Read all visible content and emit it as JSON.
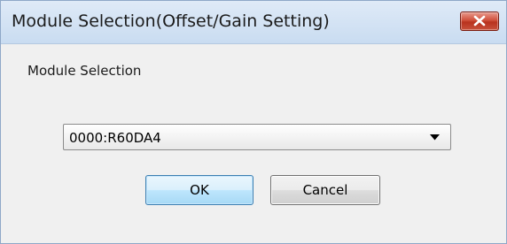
{
  "window": {
    "title": "Module Selection(Offset/Gain Setting)"
  },
  "form": {
    "label": "Module Selection",
    "module_select": {
      "value": "0000:R60DA4"
    }
  },
  "buttons": {
    "ok_label": "OK",
    "cancel_label": "Cancel"
  },
  "icons": {
    "close": "close-icon",
    "dropdown": "chevron-down-icon"
  },
  "colors": {
    "title_bar": "#c9dcf1",
    "close_button": "#c9513c",
    "ok_button_border": "#3c7fb1",
    "dialog_background": "#f0f0f0"
  }
}
